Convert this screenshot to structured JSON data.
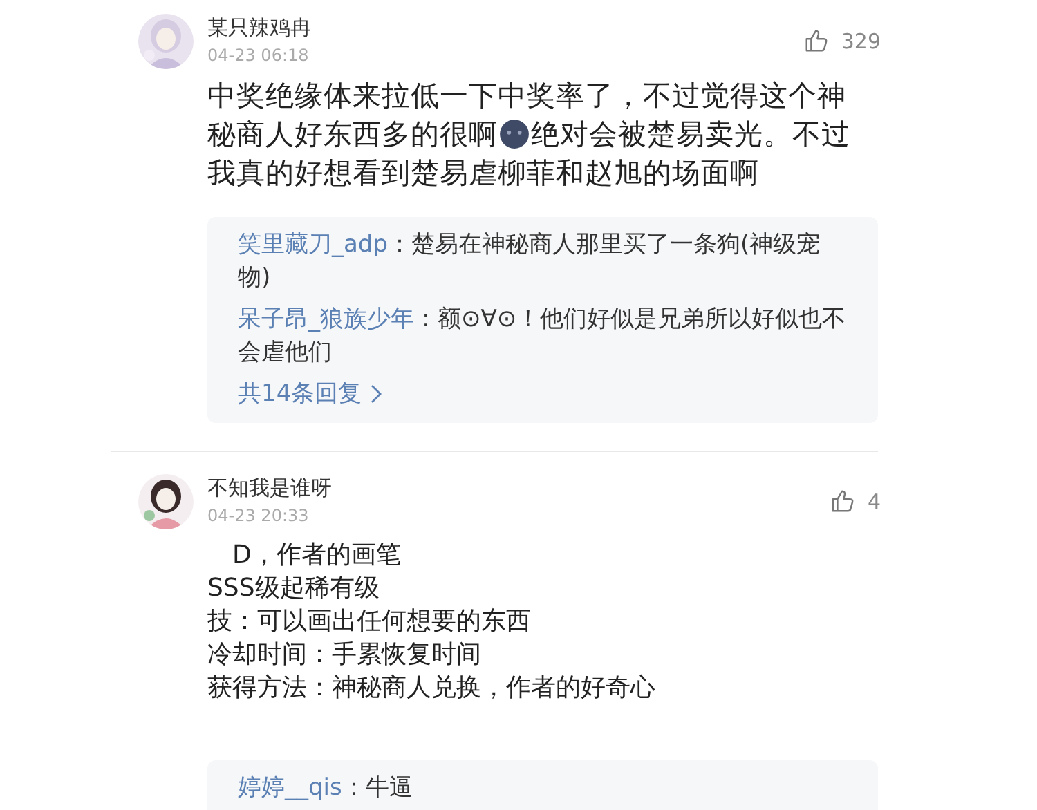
{
  "comments": [
    {
      "author": "某只辣鸡冉",
      "time": "04-23 06:18",
      "likes": "329",
      "lines": [
        {
          "parts": [
            "中奖绝缘体来拉低一下中奖率了，不过觉得这个神"
          ]
        },
        {
          "parts": [
            "秘商人好东西多的很啊",
            "绝对会被楚易卖光。不过"
          ]
        },
        {
          "parts": [
            "我真的好想看到楚易虐柳菲和赵旭的场面啊"
          ]
        }
      ],
      "replies": [
        {
          "name": "笑里藏刀_adp",
          "text": "：楚易在神秘商人那里买了一条狗(神级宠物)"
        },
        {
          "name": "呆子昂_狼族少年",
          "text": "：额⊙∀⊙！他们好似是兄弟所以好似也不会虐他们"
        }
      ],
      "more": "共14条回复"
    },
    {
      "author": "不知我是谁呀",
      "time": "04-23 20:33",
      "likes": "4",
      "lines": [
        {
          "parts": [
            "　D，作者的画笔"
          ]
        },
        {
          "parts": [
            "SSS级起稀有级"
          ]
        },
        {
          "parts": [
            "技：可以画出任何想要的东西"
          ]
        },
        {
          "parts": [
            "冷却时间：手累恢复时间"
          ]
        },
        {
          "parts": [
            "获得方法：神秘商人兑换，作者的好奇心"
          ]
        }
      ],
      "replies": [
        {
          "name": "婷婷__qis",
          "text": "：牛逼"
        }
      ]
    }
  ]
}
